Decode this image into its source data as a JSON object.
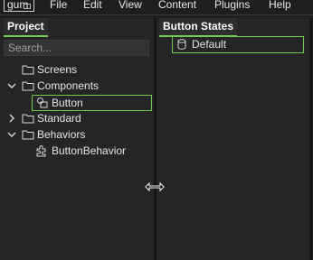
{
  "menubar": {
    "logo": "gum",
    "items": [
      "File",
      "Edit",
      "View",
      "Content",
      "Plugins",
      "Help"
    ]
  },
  "project_panel": {
    "tab": "Project",
    "search_placeholder": "Search...",
    "tree": [
      {
        "label": "Screens",
        "icon": "folder-icon",
        "expanded": false
      },
      {
        "label": "Components",
        "icon": "folder-icon",
        "expanded": true
      },
      {
        "label": "Button",
        "icon": "component-icon",
        "selected": true
      },
      {
        "label": "Standard",
        "icon": "folder-icon",
        "expanded": false
      },
      {
        "label": "Behaviors",
        "icon": "folder-icon",
        "expanded": true
      },
      {
        "label": "ButtonBehavior",
        "icon": "behavior-icon"
      }
    ]
  },
  "states_panel": {
    "tab": "Button States",
    "items": [
      {
        "label": "Default",
        "icon": "database-icon"
      }
    ]
  },
  "colors": {
    "accent": "#6fcf4a",
    "panel_bg": "#252526",
    "app_bg": "#1e1e1e"
  }
}
